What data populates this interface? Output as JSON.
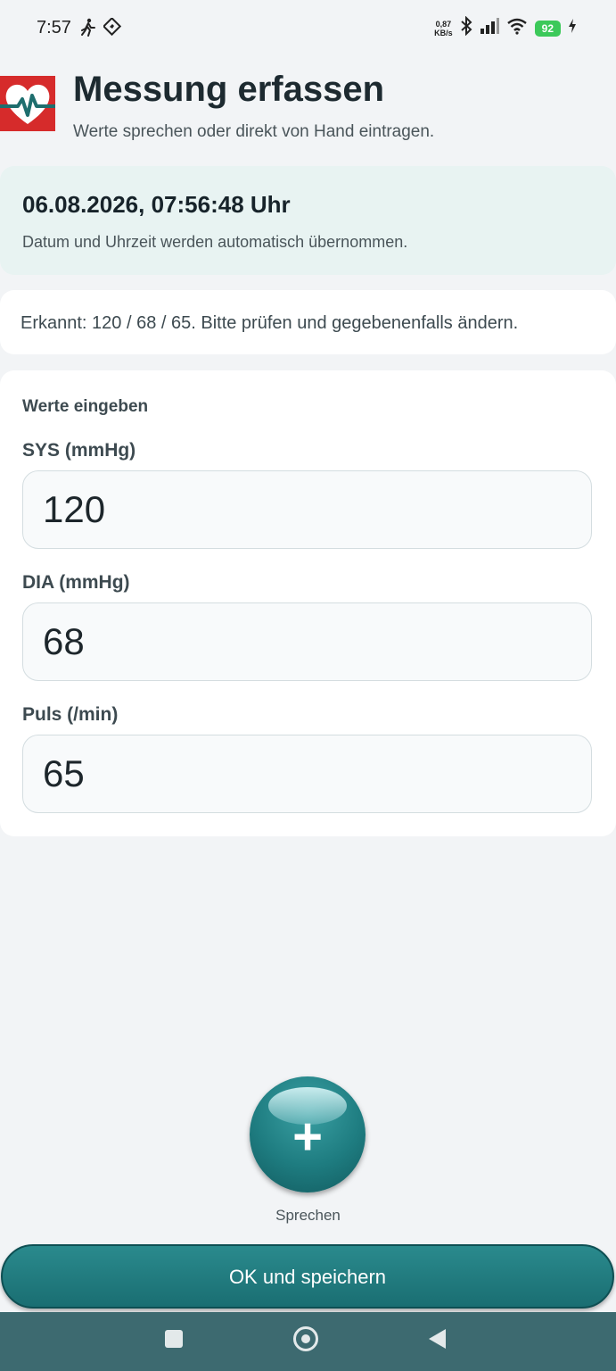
{
  "status_bar": {
    "time": "7:57",
    "net_speed_value": "0,87",
    "net_speed_unit": "KB/s",
    "battery": "92"
  },
  "header": {
    "title": "Messung erfassen",
    "subtitle": "Werte sprechen oder direkt von Hand eintragen."
  },
  "date_card": {
    "datetime": "06.08.2026, 07:56:48 Uhr",
    "note": "Datum und Uhrzeit werden automatisch übernommen."
  },
  "recognized": {
    "text": "Erkannt: 120 / 68 / 65. Bitte prüfen und gegebenenfalls ändern."
  },
  "form": {
    "heading": "Werte eingeben",
    "sys_label": "SYS (mmHg)",
    "sys_value": "120",
    "dia_label": "DIA (mmHg)",
    "dia_value": "68",
    "pulse_label": "Puls (/min)",
    "pulse_value": "65"
  },
  "speak": {
    "label": "Sprechen",
    "symbol": "+"
  },
  "save": {
    "label": "OK und speichern"
  },
  "colors": {
    "accent": "#1e7c80",
    "date_card_bg": "#e8f3f2",
    "navbar_bg": "#3d6a70",
    "battery": "#3cc95a",
    "logo_red": "#d62b2b"
  }
}
